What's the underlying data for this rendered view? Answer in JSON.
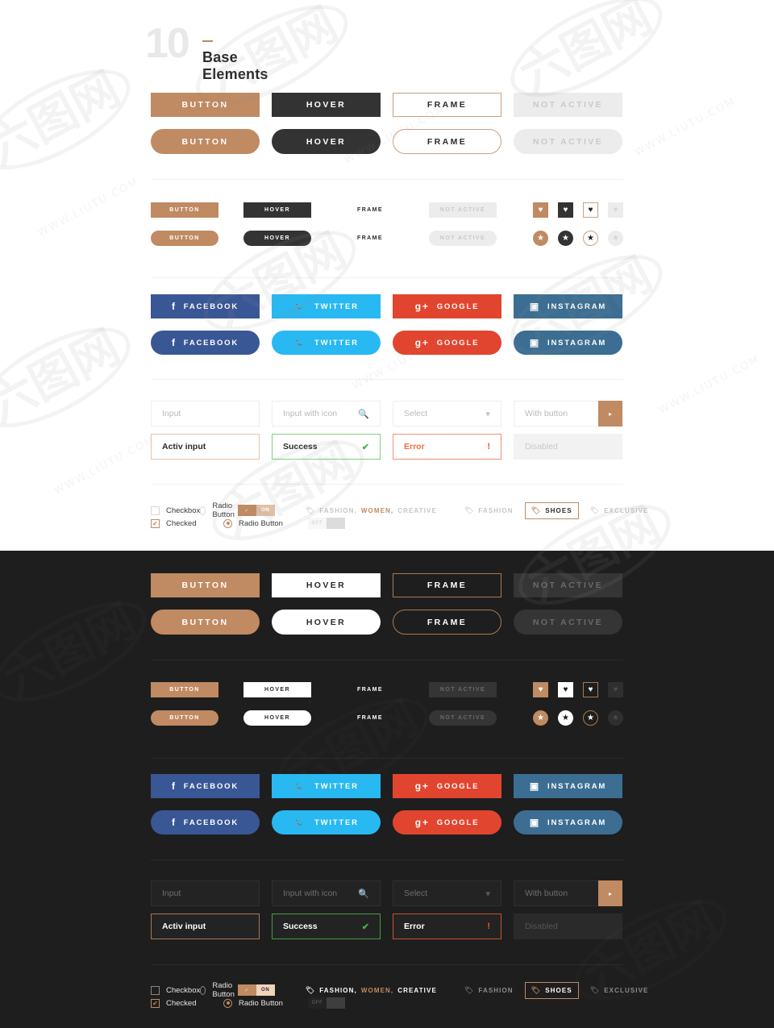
{
  "header": {
    "number": "10",
    "title": "Base Elements"
  },
  "buttons": {
    "light": [
      {
        "label": "BUTTON",
        "style": "b-solid",
        "name": "button-solid"
      },
      {
        "label": "HOVER",
        "style": "b-hover",
        "name": "button-hover"
      },
      {
        "label": "FRAME",
        "style": "b-frame",
        "name": "button-frame"
      },
      {
        "label": "NOT ACTIVE",
        "style": "b-na",
        "name": "button-not-active"
      }
    ],
    "dark": [
      {
        "label": "BUTTON",
        "style": "d-solid",
        "name": "button-solid"
      },
      {
        "label": "HOVER",
        "style": "d-hover",
        "name": "button-hover"
      },
      {
        "label": "FRAME",
        "style": "d-frame",
        "name": "button-frame"
      },
      {
        "label": "NOT ACTIVE",
        "style": "d-na",
        "name": "button-not-active"
      }
    ]
  },
  "icons": {
    "heart": "♥",
    "star": "★",
    "search": "🔍",
    "chevron_down": "▾",
    "arrow_right": "▸",
    "check": "✔",
    "exclaim": "!",
    "tag": "🏷",
    "facebook": "f",
    "twitter": "🐦",
    "google": "g+",
    "instagram": "▣"
  },
  "social": {
    "light": [
      {
        "label": "FACEBOOK",
        "icon": "f",
        "color": "#3a5795",
        "name": "facebook-button"
      },
      {
        "label": "TWITTER",
        "icon": "🐦",
        "color": "#28b8f2",
        "name": "twitter-button"
      },
      {
        "label": "GOOGLE",
        "icon": "g+",
        "color": "#e2452f",
        "name": "google-button"
      },
      {
        "label": "INSTAGRAM",
        "icon": "▣",
        "color": "#3b6e92",
        "name": "instagram-button"
      }
    ]
  },
  "inputs": {
    "row1": [
      {
        "placeholder": "Input",
        "tail": "",
        "state": "",
        "name": "plain-input"
      },
      {
        "placeholder": "Input with icon",
        "tail": "🔍",
        "state": "",
        "name": "search-input"
      },
      {
        "placeholder": "Select",
        "tail": "▾",
        "state": "",
        "name": "select-dropdown"
      }
    ],
    "with_button": {
      "placeholder": "With button",
      "button_icon": "▸",
      "name": "input-with-button"
    },
    "row2": [
      {
        "placeholder": "Activ input",
        "tail": "",
        "state": "active",
        "name": "active-input"
      },
      {
        "placeholder": "Success",
        "tail": "✔",
        "state": "success",
        "name": "success-input"
      },
      {
        "placeholder": "Error",
        "tail": "!",
        "state": "error",
        "name": "error-input"
      },
      {
        "placeholder": "Disabled",
        "tail": "",
        "state": "disabled",
        "name": "disabled-input"
      }
    ]
  },
  "controls": {
    "checkbox_label": "Checkbox",
    "checked_label": "Checked",
    "radio_label": "Radio Button",
    "toggle_on": "ON",
    "toggle_off": "OFF",
    "tag_text_parts": [
      "FASHION,",
      "WOMEN,",
      "CREATIVE"
    ],
    "chips": [
      {
        "label": "FASHION",
        "active": false,
        "name": "tag-fashion"
      },
      {
        "label": "SHOES",
        "active": true,
        "name": "tag-shoes"
      },
      {
        "label": "EXCLUSIVE",
        "active": false,
        "name": "tag-exclusive"
      }
    ]
  },
  "colors": {
    "accent": "#c08a62",
    "dark": "#333333",
    "dark_bg": "#1e1e1e",
    "success": "#4caf50",
    "error": "#ef5a23",
    "facebook": "#3a5795",
    "twitter": "#28b8f2",
    "google": "#e2452f",
    "instagram": "#3b6e92"
  },
  "watermark": {
    "text": "六图网",
    "sub": "WWW.LIUTU.COM"
  }
}
